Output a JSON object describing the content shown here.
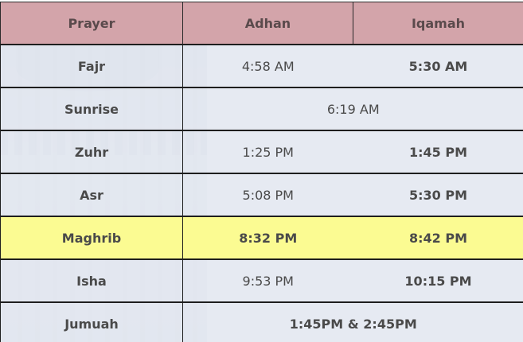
{
  "header": {
    "prayer": "Prayer",
    "adhan": "Adhan",
    "iqamah": "Iqamah"
  },
  "rows": [
    {
      "name": "Fajr",
      "adhan": "4:58 AM",
      "iqamah": "5:30 AM"
    },
    {
      "name": "Sunrise",
      "time": "6:19 AM"
    },
    {
      "name": "Zuhr",
      "adhan": "1:25 PM",
      "iqamah": "1:45 PM"
    },
    {
      "name": "Asr",
      "adhan": "5:08 PM",
      "iqamah": "5:30 PM"
    },
    {
      "name": "Maghrib",
      "adhan": "8:32 PM",
      "iqamah": "8:42 PM"
    },
    {
      "name": "Isha",
      "adhan": "9:53 PM",
      "iqamah": "10:15 PM"
    },
    {
      "name": "Jumuah",
      "time": "1:45PM & 2:45PM"
    }
  ],
  "colors": {
    "header_bg": "#d3a4aa",
    "row_bg": "#e2e6f0",
    "highlight_bg": "#fbfb92"
  }
}
